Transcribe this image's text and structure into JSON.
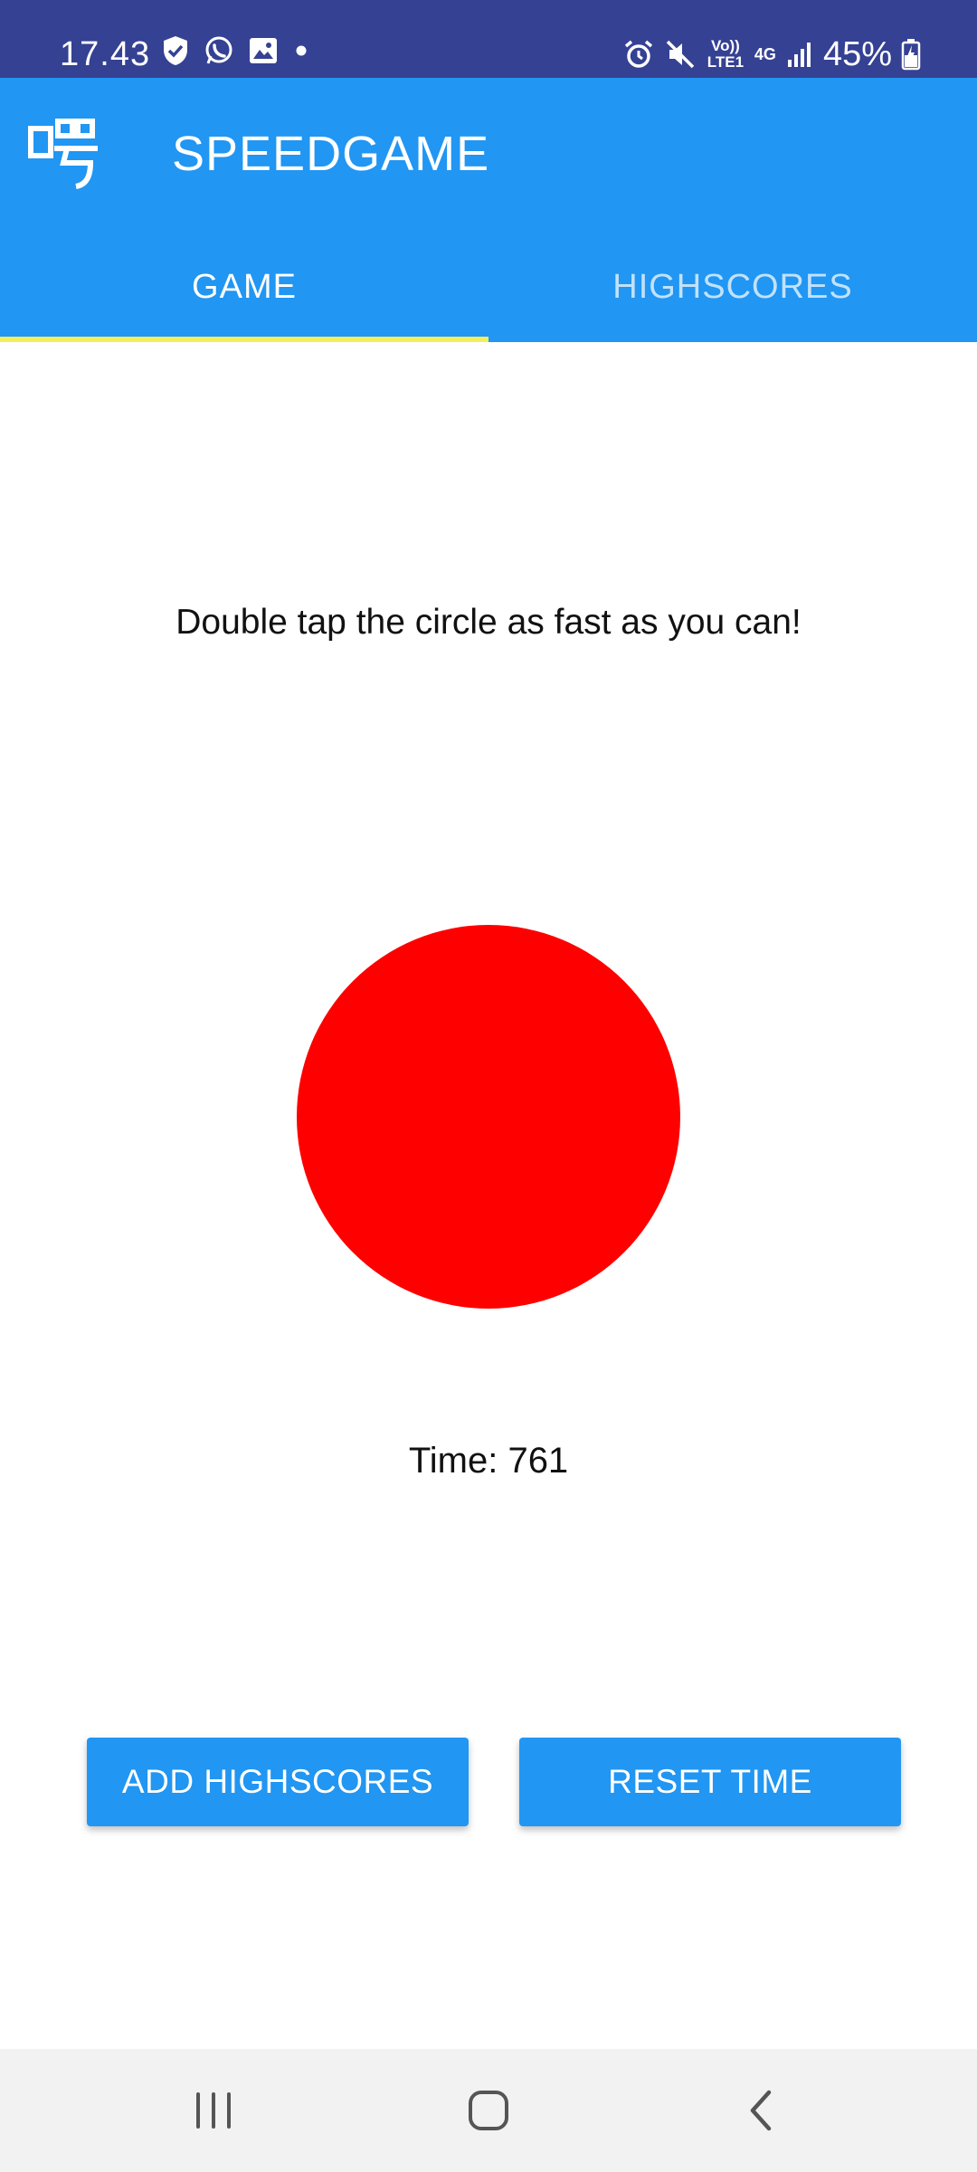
{
  "status_bar": {
    "time": "17.43",
    "lte_label": "Vo)) LTE1",
    "network_label": "4G",
    "battery_percent": "45%",
    "icons": [
      "shield-check-icon",
      "whatsapp-icon",
      "gallery-icon",
      "dot-icon",
      "alarm-icon",
      "mute-icon",
      "volte-icon",
      "4g-icon",
      "signal-icon",
      "battery-charging-icon"
    ]
  },
  "app_bar": {
    "logo": "app-logo-icon",
    "title": "SPEEDGAME",
    "tabs": [
      {
        "label": "GAME",
        "active": true
      },
      {
        "label": "HIGHSCORES",
        "active": false
      }
    ]
  },
  "game": {
    "instruction": "Double tap the circle as fast as you can!",
    "circle_color": "#ff0000",
    "time_label": "Time: 761"
  },
  "buttons": {
    "add_highscores": "ADD HIGHSCORES",
    "reset_time": "RESET TIME"
  },
  "colors": {
    "status_bar": "#354193",
    "primary": "#2196f3",
    "tab_indicator": "#f5ee5a"
  },
  "nav_bar": {
    "icons": [
      "recent-apps-icon",
      "home-icon",
      "back-icon"
    ]
  }
}
